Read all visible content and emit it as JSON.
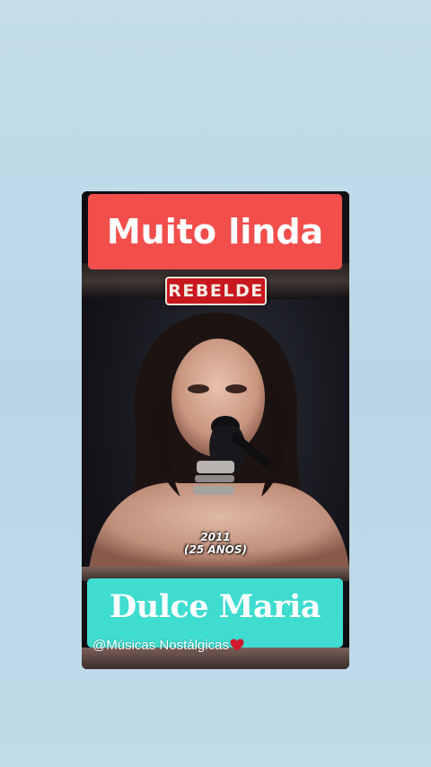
{
  "post": {
    "title_banner": "Muito linda",
    "brand_logo_text": "REBELDE",
    "year_caption": {
      "year": "2011",
      "age": "(25 ANOS)"
    },
    "name_banner": "Dulce Maria",
    "handle": "@Músicas Nostálgicas"
  },
  "colors": {
    "background": "#bcd8e7",
    "title_banner": "#f24f4c",
    "name_banner": "#3fdcd0",
    "brand_logo": "#c8171d",
    "heart": "#d2182b"
  },
  "icons": {
    "heart": "heart-icon"
  }
}
